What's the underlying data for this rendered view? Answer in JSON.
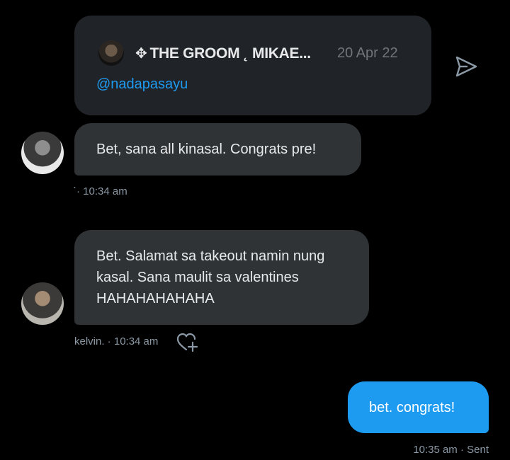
{
  "quote": {
    "author": "THE GROOM ˛ MIKAE...",
    "date": "20 Apr 22",
    "handle": "@nadapasayu"
  },
  "messages": [
    {
      "text": "Bet, sana all kinasal. Congrats pre!",
      "meta": "ˋ· 10:34 am"
    },
    {
      "text": "Bet. Salamat sa takeout namin nung\nkasal. Sana maulit sa valentines\nHAHAHAHAHAHA",
      "meta": "kelvin. · 10:34 am"
    },
    {
      "text": "bet. congrats!",
      "meta": "10:35 am · Sent"
    }
  ],
  "icons": {
    "share": "paper-plane-icon",
    "react": "heart-plus-icon",
    "quote_badge": "diamond-icon"
  },
  "colors": {
    "background": "#000000",
    "card": "#202327",
    "bubble_incoming": "#2f3336",
    "bubble_outgoing": "#1d9bf0",
    "link": "#1d9bf0"
  }
}
